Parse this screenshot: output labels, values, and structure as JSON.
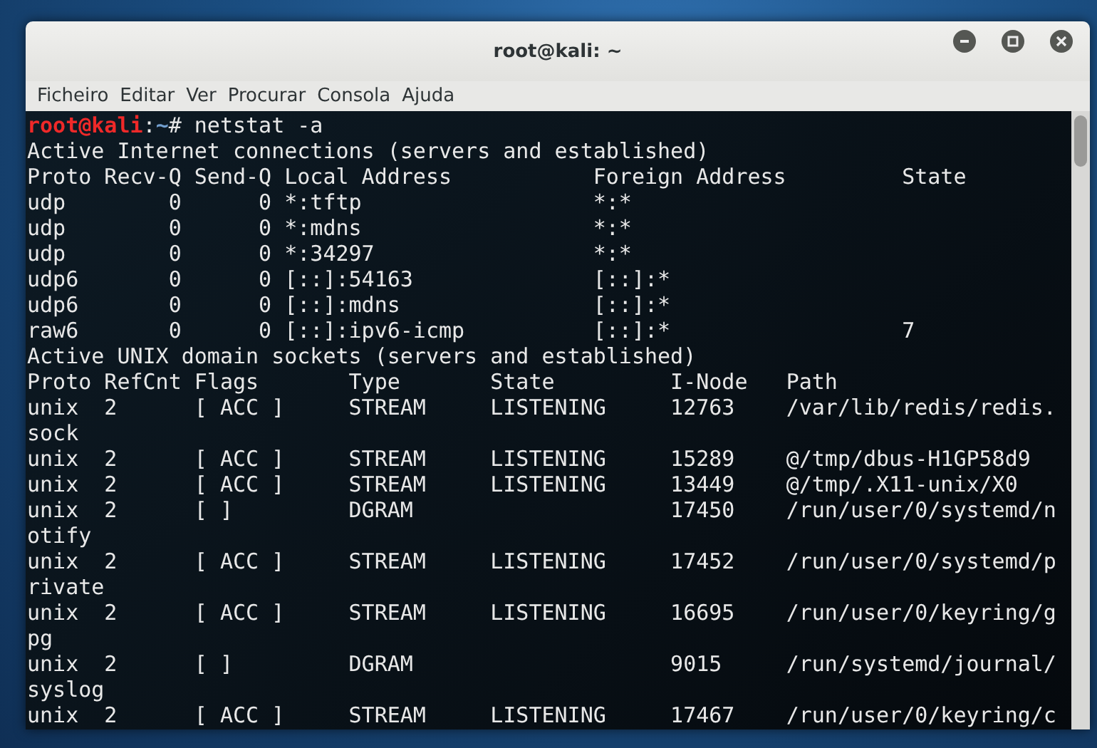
{
  "window": {
    "title": "root@kali: ~"
  },
  "menu": [
    "Ficheiro",
    "Editar",
    "Ver",
    "Procurar",
    "Consola",
    "Ajuda"
  ],
  "terminal": {
    "lines": [
      {
        "kind": "prompt",
        "user": "root@kali",
        "sep": ":",
        "path": "~",
        "command": "# netstat -a"
      },
      {
        "kind": "output",
        "text": "Active Internet connections (servers and established)"
      },
      {
        "kind": "output",
        "text": "Proto Recv-Q Send-Q Local Address           Foreign Address         State"
      },
      {
        "kind": "output",
        "text": "udp        0      0 *:tftp                  *:*"
      },
      {
        "kind": "output",
        "text": "udp        0      0 *:mdns                  *:*"
      },
      {
        "kind": "output",
        "text": "udp        0      0 *:34297                 *:*"
      },
      {
        "kind": "output",
        "text": "udp6       0      0 [::]:54163              [::]:*"
      },
      {
        "kind": "output",
        "text": "udp6       0      0 [::]:mdns               [::]:*"
      },
      {
        "kind": "output",
        "text": "raw6       0      0 [::]:ipv6-icmp          [::]:*                  7"
      },
      {
        "kind": "output",
        "text": "Active UNIX domain sockets (servers and established)"
      },
      {
        "kind": "output",
        "text": "Proto RefCnt Flags       Type       State         I-Node   Path"
      },
      {
        "kind": "output",
        "text": "unix  2      [ ACC ]     STREAM     LISTENING     12763    /var/lib/redis/redis."
      },
      {
        "kind": "output",
        "text": "sock"
      },
      {
        "kind": "output",
        "text": "unix  2      [ ACC ]     STREAM     LISTENING     15289    @/tmp/dbus-H1GP58d9"
      },
      {
        "kind": "output",
        "text": "unix  2      [ ACC ]     STREAM     LISTENING     13449    @/tmp/.X11-unix/X0"
      },
      {
        "kind": "output",
        "text": "unix  2      [ ]         DGRAM                    17450    /run/user/0/systemd/n"
      },
      {
        "kind": "output",
        "text": "otify"
      },
      {
        "kind": "output",
        "text": "unix  2      [ ACC ]     STREAM     LISTENING     17452    /run/user/0/systemd/p"
      },
      {
        "kind": "output",
        "text": "rivate"
      },
      {
        "kind": "output",
        "text": "unix  2      [ ACC ]     STREAM     LISTENING     16695    /run/user/0/keyring/g"
      },
      {
        "kind": "output",
        "text": "pg"
      },
      {
        "kind": "output",
        "text": "unix  2      [ ]         DGRAM                    9015     /run/systemd/journal/"
      },
      {
        "kind": "output",
        "text": "syslog"
      },
      {
        "kind": "output",
        "text": "unix  2      [ ACC ]     STREAM     LISTENING     17467    /run/user/0/keyring/c"
      }
    ]
  }
}
